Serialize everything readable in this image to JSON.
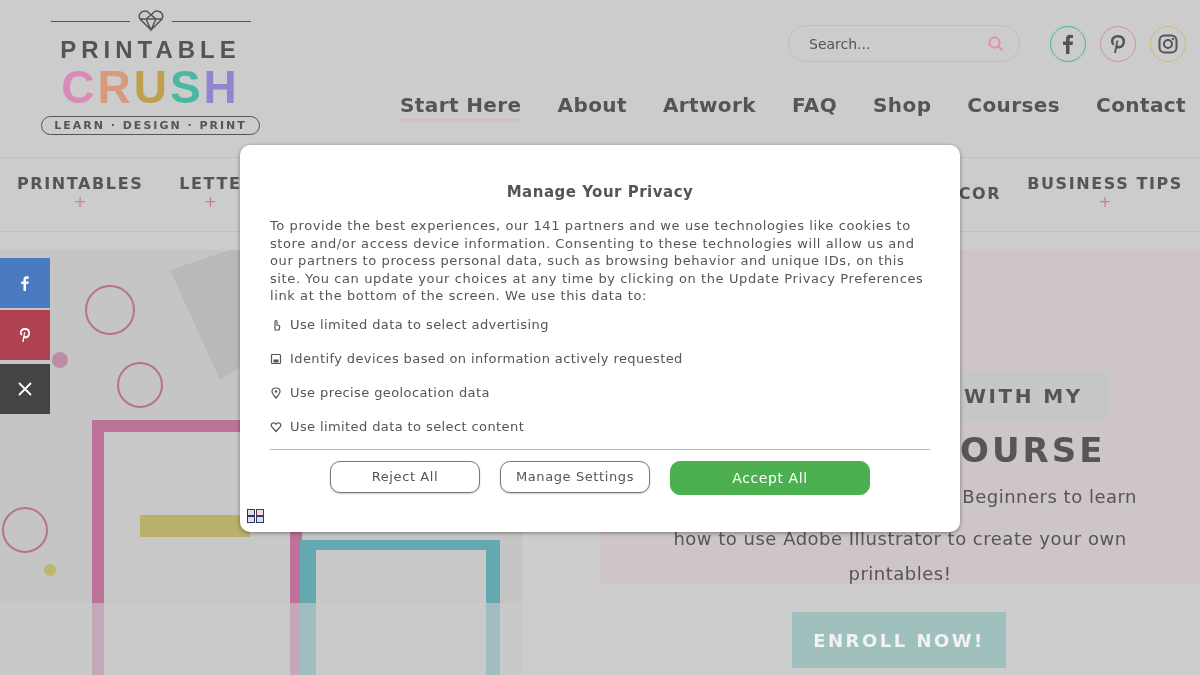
{
  "logo": {
    "top": "PRINTABLE",
    "letters": [
      {
        "text": "C",
        "color": "#d88bba"
      },
      {
        "text": "R",
        "color": "#d99a7c"
      },
      {
        "text": "U",
        "color": "#bf9e4c"
      },
      {
        "text": "S",
        "color": "#49b8a2"
      },
      {
        "text": "H",
        "color": "#8f86cf"
      }
    ],
    "tagline": "LEARN · DESIGN · PRINT"
  },
  "search": {
    "placeholder": "Search..."
  },
  "social": [
    {
      "kind": "facebook",
      "color": "#46b89f"
    },
    {
      "kind": "pinterest",
      "color": "#d88ab8"
    },
    {
      "kind": "instagram",
      "color": "#d4b86c"
    }
  ],
  "nav": [
    {
      "label": "Start Here",
      "selected": true
    },
    {
      "label": "About",
      "selected": false
    },
    {
      "label": "Artwork",
      "selected": false
    },
    {
      "label": "FAQ",
      "selected": false
    },
    {
      "label": "Shop",
      "selected": false
    },
    {
      "label": "Courses",
      "selected": false
    },
    {
      "label": "Contact",
      "selected": false
    }
  ],
  "categories_left": [
    {
      "label": "PRINTABLES",
      "mark": "+"
    },
    {
      "label": "LETTE",
      "mark": "+"
    }
  ],
  "categories_right": [
    {
      "label": "COR"
    },
    {
      "label": "BUSINESS TIPS",
      "mark": "+"
    }
  ],
  "share_bar": [
    {
      "kind": "facebook",
      "color": "#4a7ac0"
    },
    {
      "kind": "pinterest",
      "color": "#b04150"
    },
    {
      "kind": "x",
      "color": "#444444"
    }
  ],
  "hero": {
    "kind": "picture",
    "eyebrow": "WITH MY",
    "heading": "OURSE",
    "lines": [
      "Beginners to learn",
      "how to use Adobe Illustrator to create your own",
      "printables!"
    ],
    "button": "ENROLL NOW!"
  },
  "privacy_dialog": {
    "title": "Manage Your Privacy",
    "text": "To provide the best experiences, our 141 partners and we use technologies like cookies to store and/or access device information. Consenting to these technologies will allow us and our partners to process personal data, such as browsing behavior and unique IDs, on this site. You can update your choices at any time by clicking on the Update Privacy Preferences link at the bottom of the screen. We use this data to:",
    "purposes": [
      "Use limited data to select advertising",
      "Identify devices based on information actively requested",
      "Use precise geolocation data",
      "Use limited data to select content"
    ],
    "buttons": [
      {
        "label": "Reject All",
        "kind": "outline"
      },
      {
        "label": "Manage Settings",
        "kind": "outline"
      },
      {
        "label": "Accept All",
        "kind": "primary"
      }
    ]
  }
}
